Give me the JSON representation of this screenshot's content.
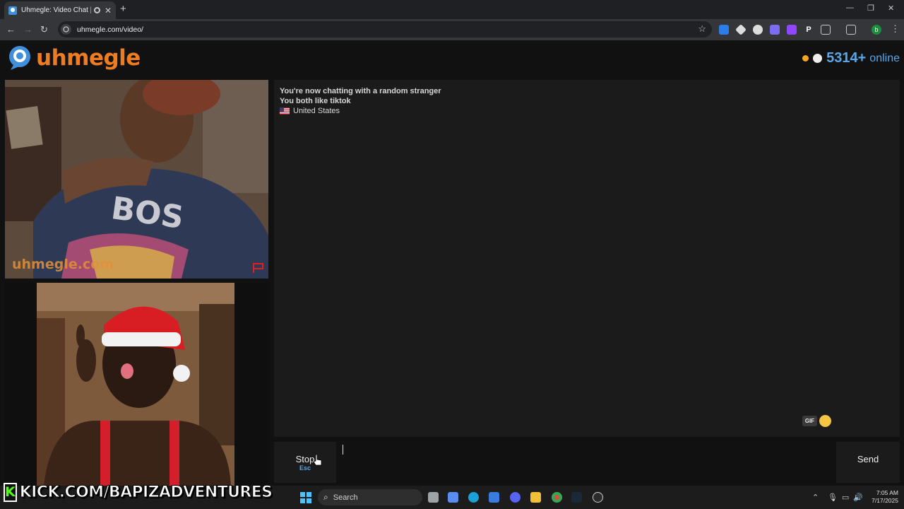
{
  "browser": {
    "tab_title": "Uhmegle: Video Chat | Ome",
    "tab_close": "✕",
    "new_tab": "+",
    "url": "uhmegle.com/video/",
    "profile_initial": "b",
    "window_controls": [
      "—",
      "❐",
      "✕"
    ]
  },
  "site": {
    "logo_text": "uhmegle",
    "online_count": "5314+",
    "online_label": "online",
    "watermark": "uhmegle.com"
  },
  "chat": {
    "lines": [
      "You're now chatting with a random stranger",
      "You both like tiktok"
    ],
    "country": "United States"
  },
  "controls": {
    "stop_label": "Stop",
    "stop_key": "Esc",
    "gif_label": "GIF",
    "send_label": "Send"
  },
  "overlay": {
    "kick_text": "KICK.COM/BAPIZADVENTURES",
    "kick_letter": "K"
  },
  "taskbar": {
    "search_label": "Search",
    "time": "7:05 AM",
    "date": "7/17/2025"
  },
  "colors": {
    "brand_orange": "#f07c21",
    "online_blue": "#5aa6e8",
    "kick_green": "#53fc18"
  }
}
